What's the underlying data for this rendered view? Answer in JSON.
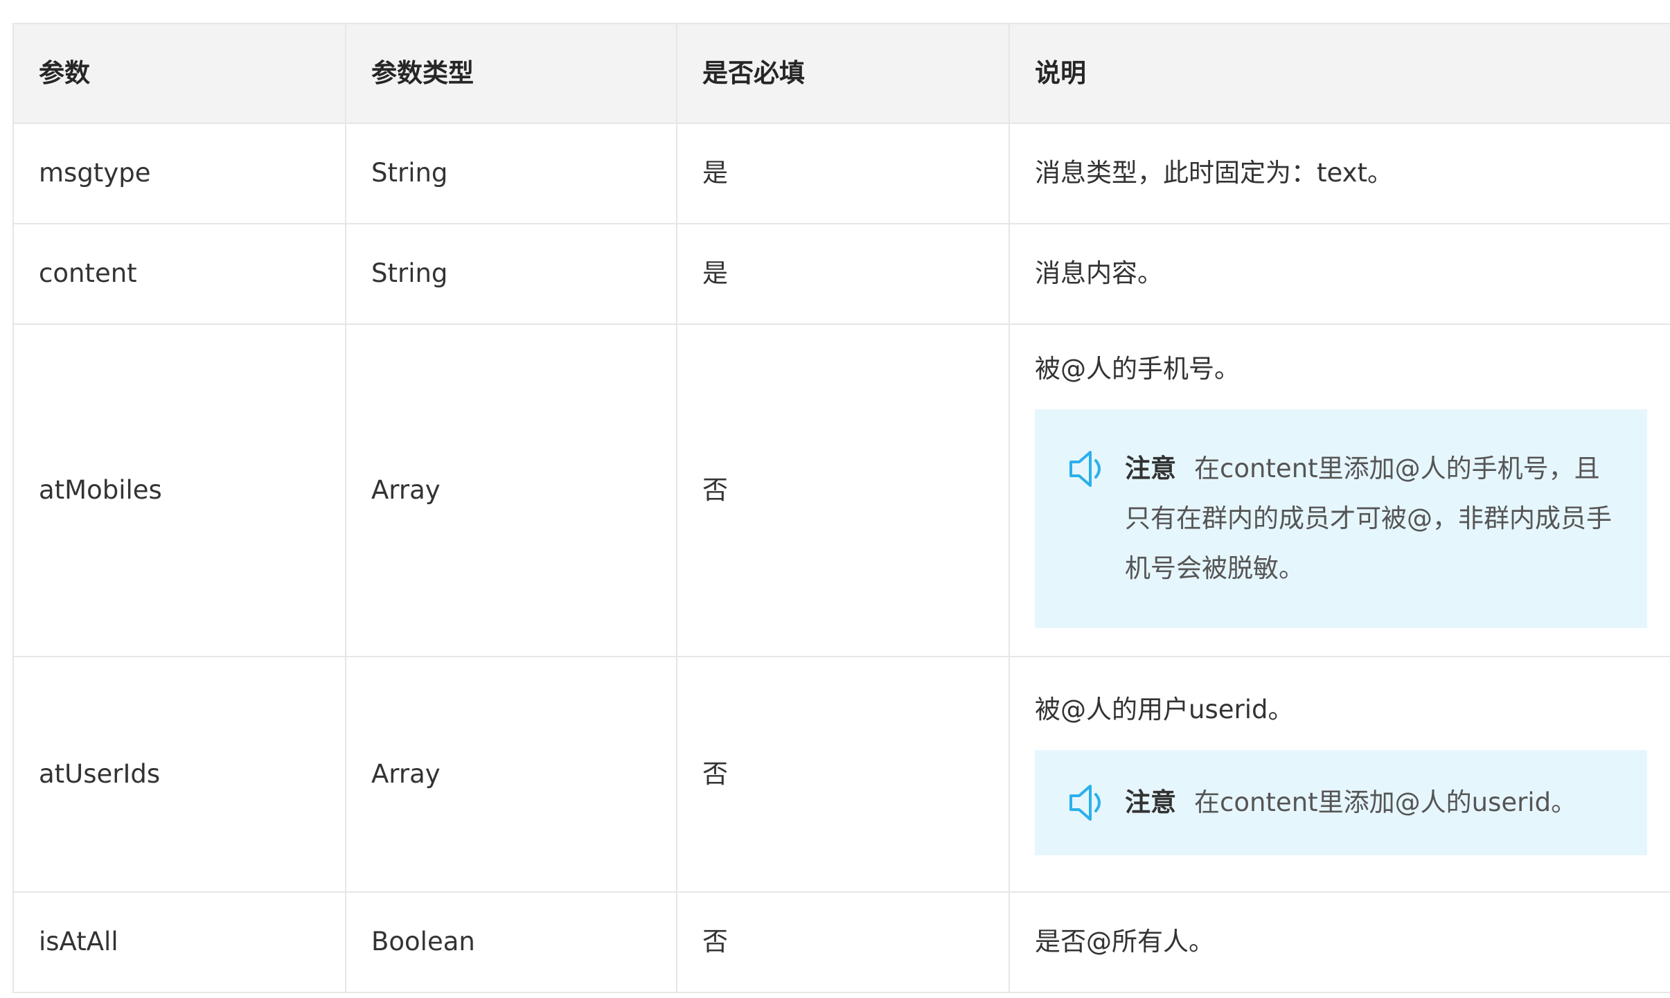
{
  "table": {
    "headers": [
      "参数",
      "参数类型",
      "是否必填",
      "说明"
    ],
    "rows": [
      {
        "name": "msgtype",
        "type": "String",
        "required": "是",
        "description": "消息类型，此时固定为：text。"
      },
      {
        "name": "content",
        "type": "String",
        "required": "是",
        "description": "消息内容。"
      },
      {
        "name": "atMobiles",
        "type": "Array",
        "required": "否",
        "description": "被@人的手机号。",
        "note": {
          "title": "注意",
          "text": "在content里添加@人的手机号，且只有在群内的成员才可被@，非群内成员手机号会被脱敏。"
        }
      },
      {
        "name": "atUserIds",
        "type": "Array",
        "required": "否",
        "description": "被@人的用户userid。",
        "note": {
          "title": "注意",
          "text": "在content里添加@人的userid。"
        }
      },
      {
        "name": "isAtAll",
        "type": "Boolean",
        "required": "否",
        "description": "是否@所有人。"
      }
    ]
  },
  "icons": {
    "note_icon": "speaker-icon"
  },
  "colors": {
    "header_bg": "#f3f3f3",
    "note_bg": "#e6f6fd",
    "note_icon": "#2bb0ea",
    "border": "#e6e6e6"
  }
}
